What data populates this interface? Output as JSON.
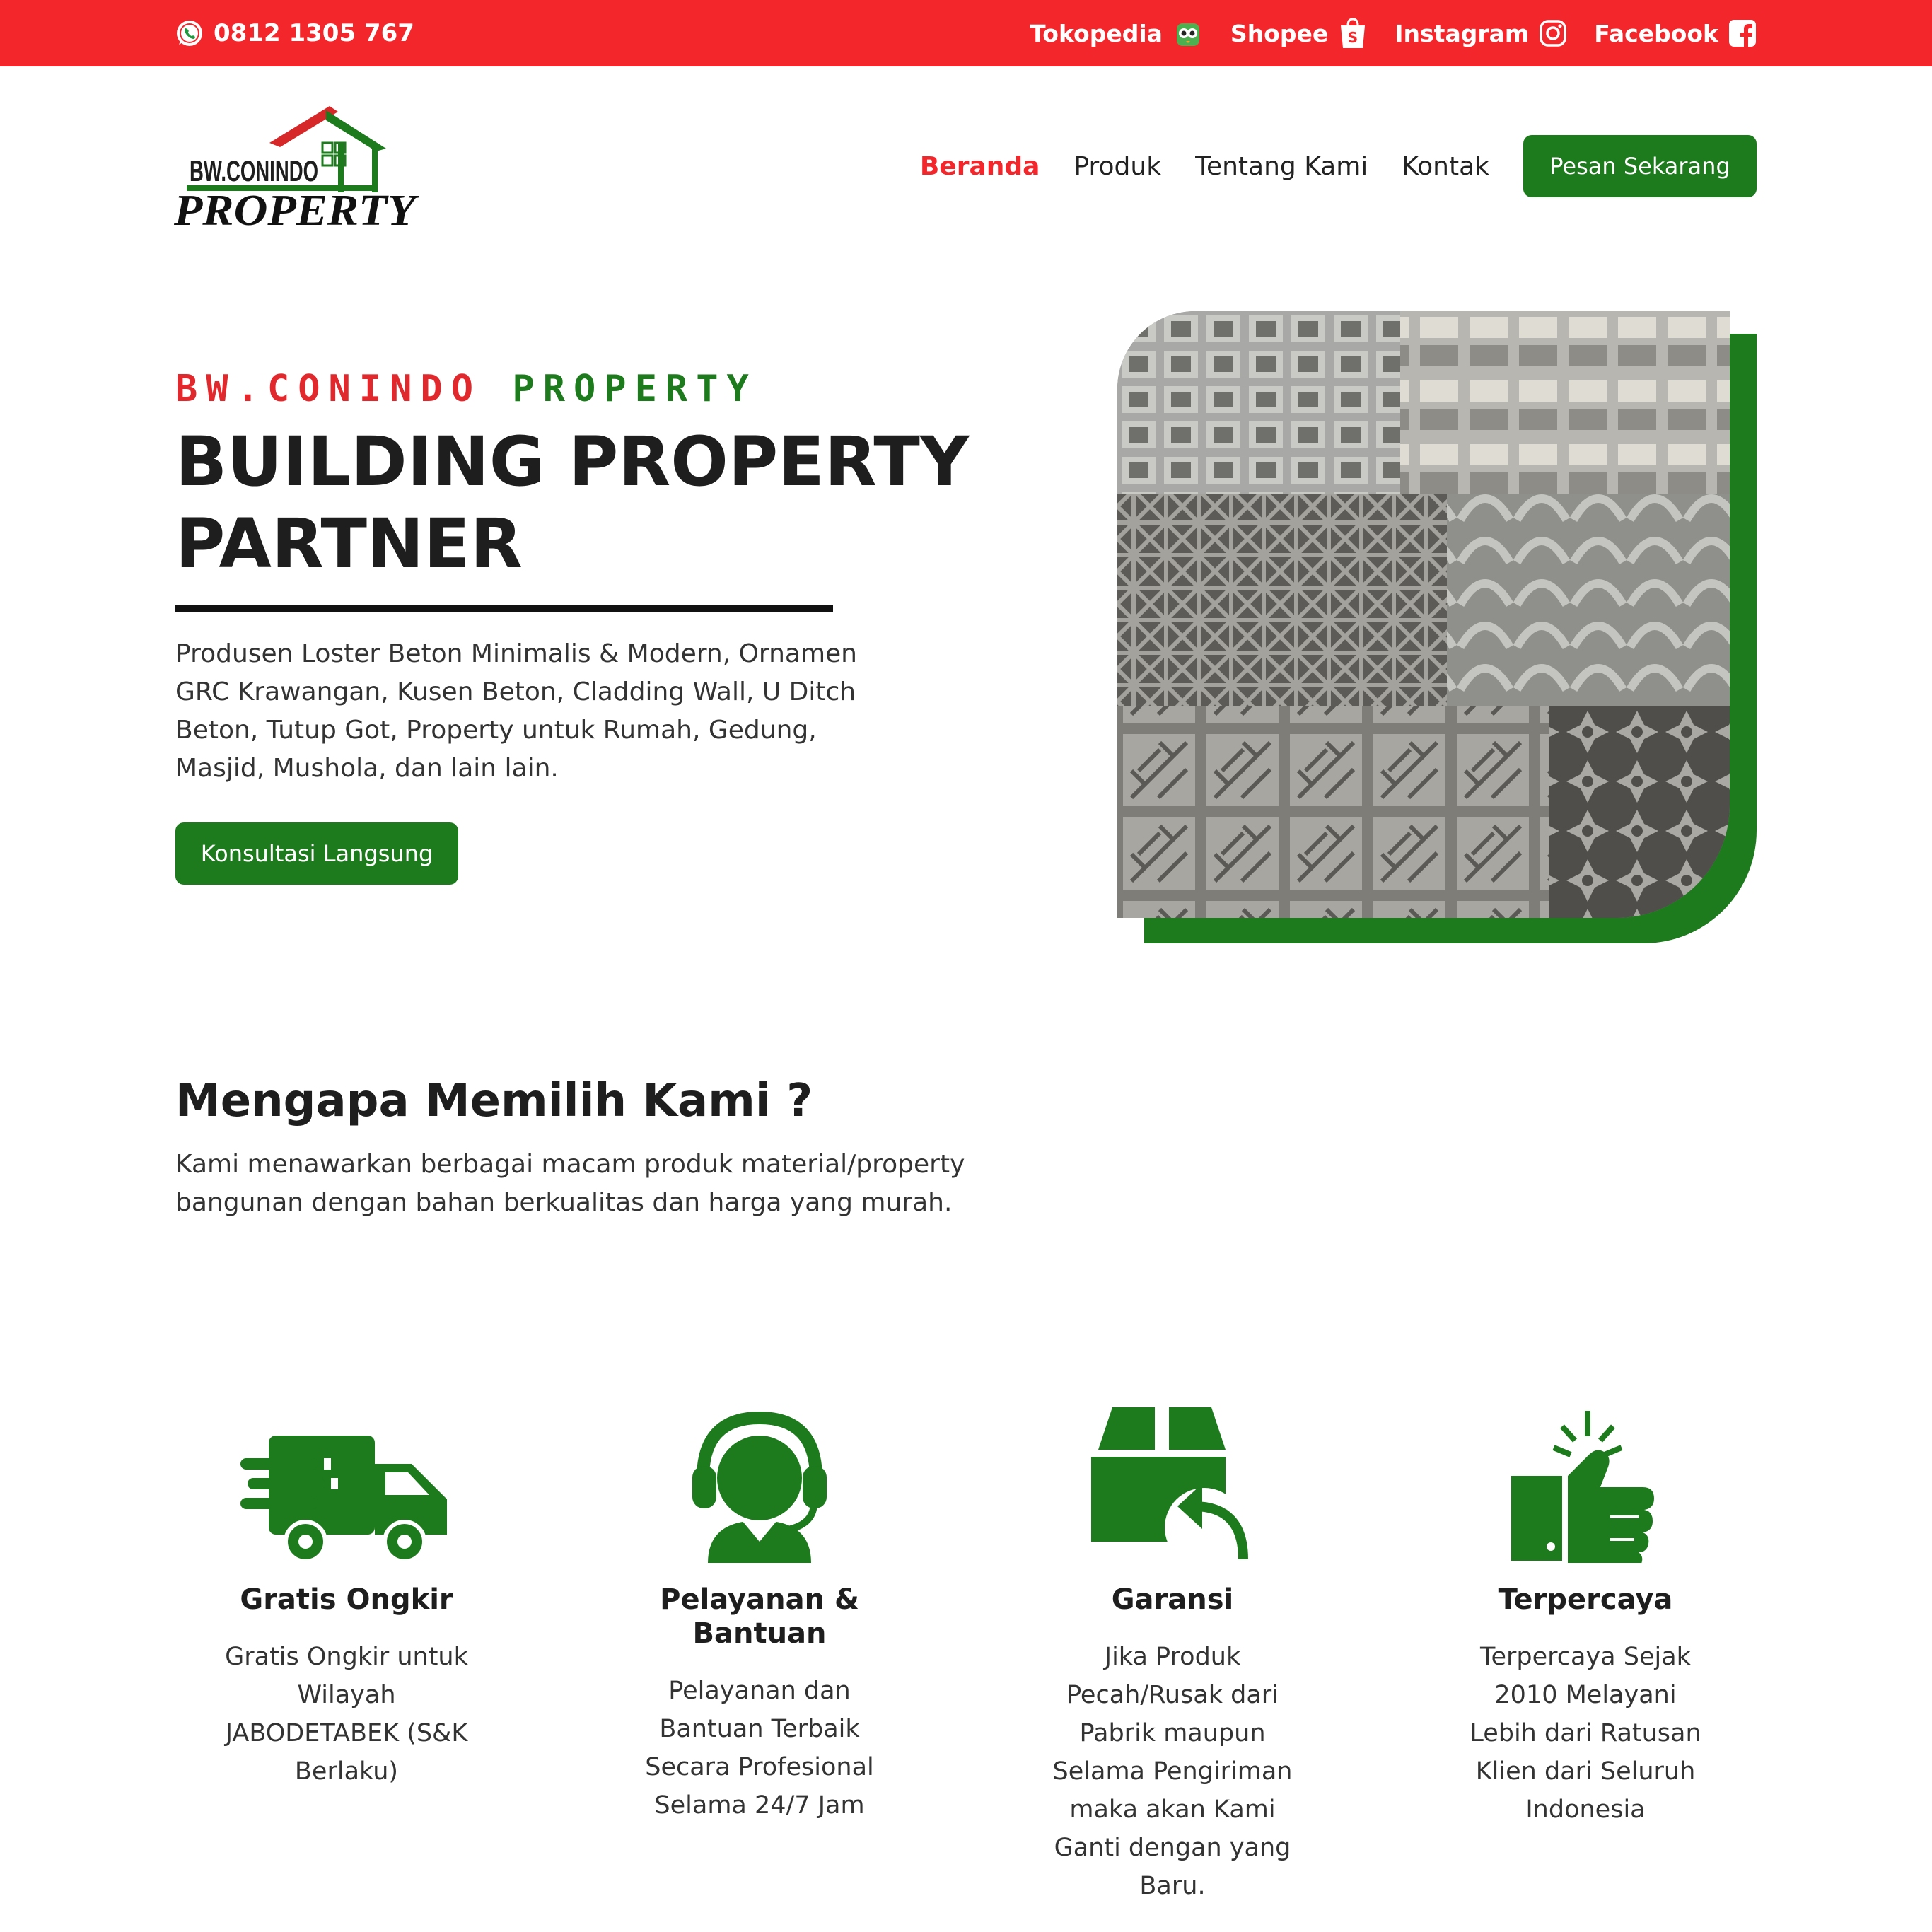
{
  "topbar": {
    "phone": "0812 1305 767",
    "socials": [
      {
        "label": "Tokopedia",
        "icon": "tokopedia-icon"
      },
      {
        "label": "Shopee",
        "icon": "shopee-bag-icon"
      },
      {
        "label": "Instagram",
        "icon": "instagram-icon"
      },
      {
        "label": "Facebook",
        "icon": "facebook-icon"
      }
    ]
  },
  "logo": {
    "top_text": "BW.CONINDO",
    "bottom_text": "PROPERTY"
  },
  "nav": {
    "items": [
      "Beranda",
      "Produk",
      "Tentang Kami",
      "Kontak"
    ],
    "active": "Beranda",
    "cta": "Pesan Sekarang"
  },
  "hero": {
    "eyebrow_red": "BW.CONINDO",
    "eyebrow_green": "PROPERTY",
    "title": "BUILDING PROPERTY PARTNER",
    "description": "Produsen Loster Beton Minimalis & Modern, Ornamen GRC Krawangan, Kusen Beton, Cladding Wall, U Ditch Beton, Tutup Got, Property untuk Rumah, Gedung, Masjid, Mushola, dan lain lain.",
    "button": "Konsultasi Langsung"
  },
  "why": {
    "title": "Mengapa Memilih Kami ?",
    "description": "Kami menawarkan berbagai macam produk material/property bangunan dengan bahan berkualitas dan harga yang murah."
  },
  "features": [
    {
      "title": "Gratis Ongkir",
      "desc": "Gratis Ongkir untuk Wilayah JABODETABEK (S&K Berlaku)",
      "icon": "delivery-truck-icon"
    },
    {
      "title": "Pelayanan & Bantuan",
      "desc": "Pelayanan dan Bantuan Terbaik Secara Profesional Selama 24/7 Jam",
      "icon": "customer-support-icon"
    },
    {
      "title": "Garansi",
      "desc": "Jika Produk Pecah/Rusak dari Pabrik maupun Selama Pengiriman maka akan Kami Ganti dengan yang Baru.",
      "icon": "box-return-icon"
    },
    {
      "title": "Terpercaya",
      "desc": "Terpercaya Sejak 2010 Melayani Lebih dari Ratusan Klien dari Seluruh Indonesia",
      "icon": "thumbs-up-icon"
    }
  ],
  "colors": {
    "red": "#f2262b",
    "green": "#1d7a1d",
    "text": "#1e1e1e"
  }
}
